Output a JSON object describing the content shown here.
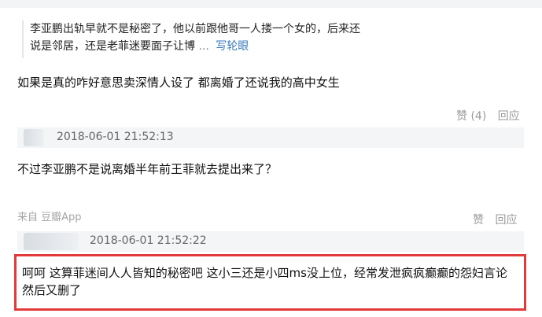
{
  "thread": {
    "quote": {
      "line1": "李亚鹏出轨早就不是秘密了，他以前跟他哥一人搂一个女的，后来还",
      "line2": "说是邻居，还是老菲迷要面子让博",
      "ellipsis": "...",
      "expand_link": "写轮眼"
    },
    "reply1": {
      "text": "如果是真的咋好意思卖深情人设了 都离婚了还说我的高中女生",
      "like_label": "赞",
      "like_count": "(4)",
      "reply_label": "回应"
    },
    "comment2": {
      "timestamp": "2018-06-01 21:52:13",
      "text": "不过李亚鹏不是说离婚半年前王菲就去提出来了？",
      "source": "来自 豆瓣App",
      "like_label": "赞",
      "reply_label": "回应"
    },
    "comment3": {
      "timestamp": "2018-06-01 21:52:22",
      "text": "呵呵 这算菲迷间人人皆知的秘密吧 这小三还是小四ms没上位，经常发泄疯疯癫癫的怨妇言论然后又删了"
    }
  },
  "colors": {
    "highlight_border": "#e23a3a",
    "link": "#3a7bbd",
    "meta_bar": "#f4f5f7"
  }
}
